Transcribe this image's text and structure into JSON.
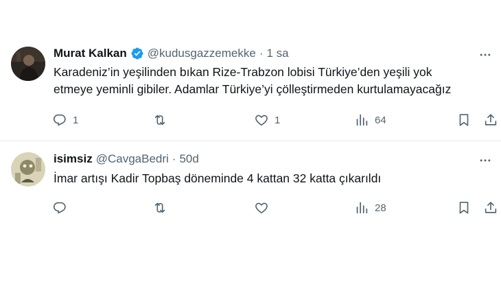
{
  "tweets": [
    {
      "name": "Murat Kalkan",
      "verified": true,
      "handle": "@kudusgazzemekke",
      "separator": "·",
      "time": "1 sa",
      "text_lines": [
        "Karadeniz’in yeşilinden bıkan Rize-Trabzon lobisi Türkiye’den yeşili yok",
        "etmeye yeminli gibiler. Adamlar Türkiye’yi çölleştirmeden kurtulamayacağız"
      ],
      "reply_count": "1",
      "retweet_count": "",
      "like_count": "1",
      "view_count": "64",
      "icons": [
        "avatar-photo",
        "verified-badge-icon",
        "more-icon",
        "reply-icon",
        "retweet-icon",
        "like-icon",
        "views-icon",
        "bookmark-icon",
        "share-icon"
      ]
    },
    {
      "name": "isimsiz",
      "verified": false,
      "handle": "@CavgaBedri",
      "separator": "·",
      "time": "50d",
      "text_lines": [
        "İmar artışı Kadir Topbaş döneminde 4 kattan 32 katta çıkarıldı"
      ],
      "reply_count": "",
      "retweet_count": "",
      "like_count": "",
      "view_count": "28",
      "icons": [
        "avatar-photo",
        "more-icon",
        "reply-icon",
        "retweet-icon",
        "like-icon",
        "views-icon",
        "bookmark-icon",
        "share-icon"
      ]
    }
  ],
  "colors": {
    "text_primary": "#0f1419",
    "text_secondary": "#536471",
    "verified_blue": "#1d9bf0",
    "divider": "#e6e9eb"
  }
}
